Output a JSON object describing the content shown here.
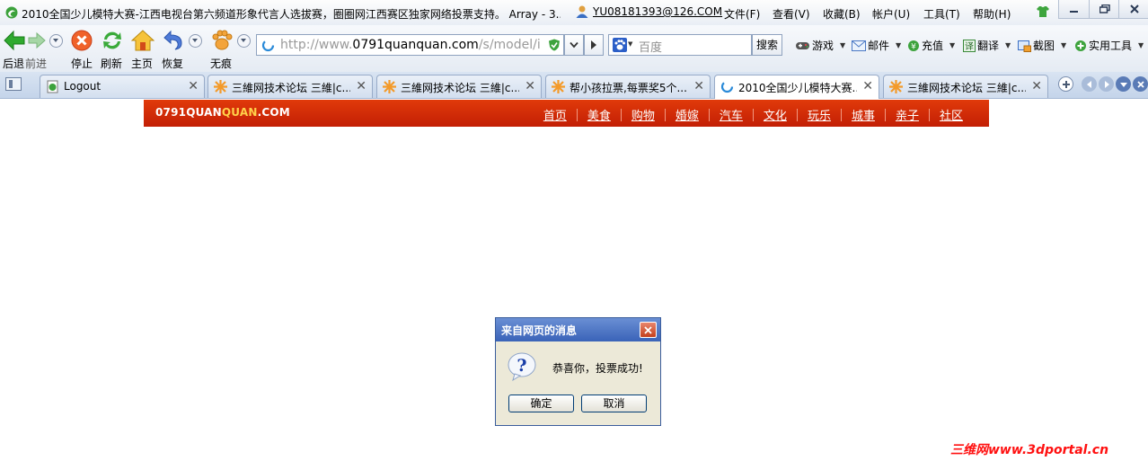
{
  "window": {
    "title": "2010全国少儿模特大赛-江西电视台第六频道形象代言人选拔赛，圈圈网江西赛区独家网络投票支持。 Array - 3...",
    "user_email": "YU08181393@126.COM",
    "menu": [
      "文件(F)",
      "查看(V)",
      "收藏(B)",
      "帐户(U)",
      "工具(T)",
      "帮助(H)"
    ]
  },
  "toolbar": {
    "back_label": "后退",
    "forward_label": "前进",
    "stop_label": "停止",
    "refresh_label": "刷新",
    "home_label": "主页",
    "restore_label": "恢复",
    "incognito_label": "无痕",
    "url_prefix": "http://www.",
    "url_domain": "0791quanquan.com",
    "url_suffix": "/s/model/index",
    "search_placeholder": "百度",
    "search_button": "搜索",
    "tools": [
      "游戏",
      "邮件",
      "充值",
      "翻译",
      "截图",
      "实用工具"
    ]
  },
  "tabs": [
    {
      "label": "Logout",
      "active": false
    },
    {
      "label": "三維网技术论坛 三維|c...",
      "active": false
    },
    {
      "label": "三維网技术论坛 三維|c...",
      "active": false
    },
    {
      "label": "帮小孩拉票,每票奖5个...",
      "active": false
    },
    {
      "label": "2010全国少儿模特大赛...",
      "active": true
    },
    {
      "label": "三維网技术论坛 三維|c...",
      "active": false
    }
  ],
  "site": {
    "logo_a": "0791QUAN",
    "logo_b": "QUAN",
    "logo_c": ".COM",
    "nav": [
      "首页",
      "美食",
      "购物",
      "婚嫁",
      "汽车",
      "文化",
      "玩乐",
      "城事",
      "亲子",
      "社区"
    ]
  },
  "dialog": {
    "title": "来自网页的消息",
    "message": "恭喜你，投票成功!",
    "ok": "确定",
    "cancel": "取消"
  },
  "watermark": "三维网www.3dportal.cn",
  "colors": {
    "site_header": "#d42a08",
    "dialog_title": "#3a63b8",
    "watermark": "#ff1010"
  }
}
